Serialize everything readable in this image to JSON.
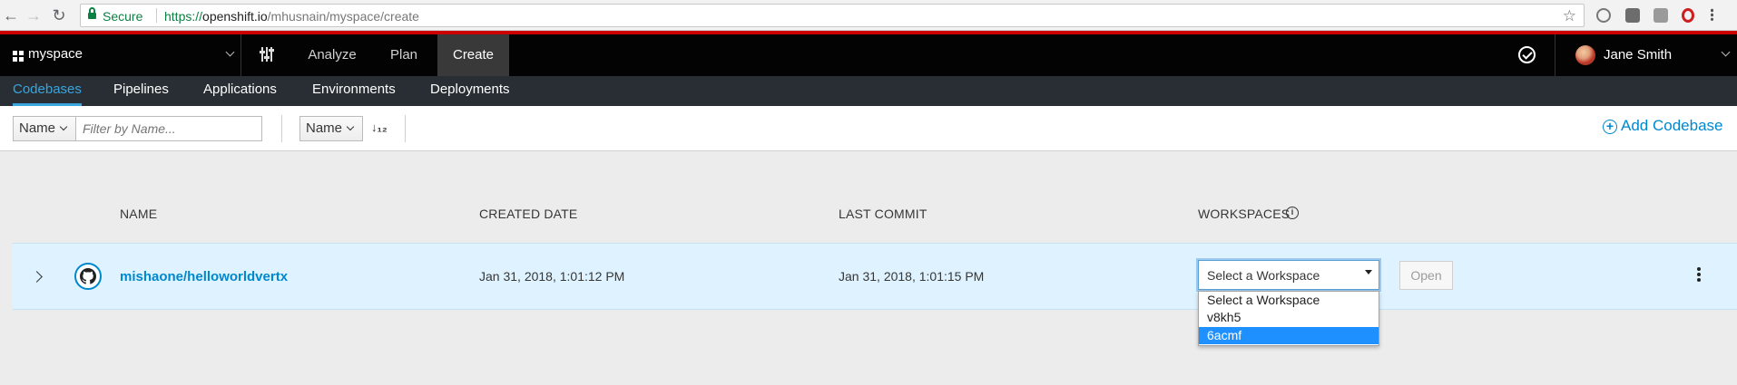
{
  "browser": {
    "secure_label": "Secure",
    "url_scheme": "https://",
    "url_host": "openshift.io",
    "url_path": "/mhusnain/myspace/create"
  },
  "topnav": {
    "space_name": "myspace",
    "items": [
      "Analyze",
      "Plan",
      "Create"
    ],
    "active_item": "Create",
    "user_name": "Jane Smith"
  },
  "subnav": {
    "items": [
      "Codebases",
      "Pipelines",
      "Applications",
      "Environments",
      "Deployments"
    ],
    "active_item": "Codebases"
  },
  "toolbar": {
    "filter_field": "Name",
    "filter_placeholder": "Filter by Name...",
    "sort_field": "Name",
    "add_label": "Add Codebase"
  },
  "table": {
    "headers": {
      "name": "NAME",
      "created": "CREATED DATE",
      "last_commit": "LAST COMMIT",
      "workspaces": "WORKSPACES"
    },
    "rows": [
      {
        "name": "mishaone/helloworldvertx",
        "created": "Jan 31, 2018, 1:01:12 PM",
        "last_commit": "Jan 31, 2018, 1:01:15 PM",
        "workspace_value": "Select a Workspace",
        "open_label": "Open"
      }
    ]
  },
  "workspace_dropdown": {
    "options": [
      "Select a Workspace",
      "v8kh5",
      "6acmf"
    ],
    "highlighted": "6acmf"
  },
  "colors": {
    "accent": "#0088ce",
    "nav_bg": "#030303",
    "subnav_bg": "#292e34",
    "row_bg": "#def3ff",
    "brand_red": "#cc0000"
  }
}
